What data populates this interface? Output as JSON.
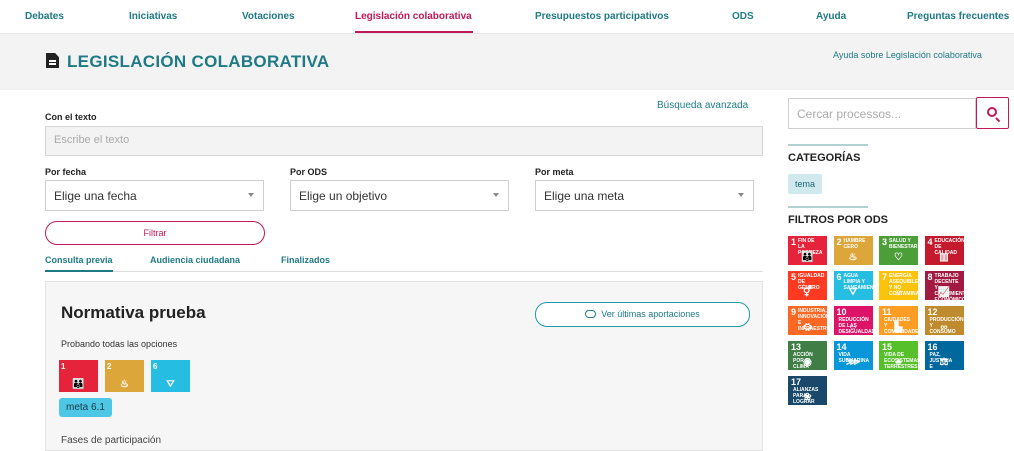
{
  "nav": {
    "items": [
      {
        "label": "Debates",
        "active": false
      },
      {
        "label": "Iniciativas",
        "active": false
      },
      {
        "label": "Votaciones",
        "active": false
      },
      {
        "label": "Legislación colaborativa",
        "active": true
      },
      {
        "label": "Presupuestos participativos",
        "active": false
      },
      {
        "label": "ODS",
        "active": false
      },
      {
        "label": "Ayuda",
        "active": false
      },
      {
        "label": "Preguntas frecuentes",
        "active": false
      }
    ]
  },
  "header": {
    "title": "LEGISLACIÓN COLABORATIVA",
    "title_icon": "document-icon",
    "help_link": "Ayuda sobre Legislación colaborativa"
  },
  "search_form": {
    "advanced_link": "Búsqueda avanzada",
    "text_label": "Con el texto",
    "text_placeholder": "Escribe el texto",
    "date_label": "Por fecha",
    "date_value": "Elige una fecha",
    "ods_label": "Por ODS",
    "ods_value": "Elige un objetivo",
    "meta_label": "Por meta",
    "meta_value": "Elige una meta",
    "filter_button": "Filtrar"
  },
  "tabs": [
    {
      "label": "Consulta previa",
      "active": true
    },
    {
      "label": "Audiencia ciudadana",
      "active": false
    },
    {
      "label": "Finalizados",
      "active": false
    }
  ],
  "card": {
    "title": "Normativa prueba",
    "view_button": "Ver últimas aportaciones",
    "description": "Probando todas las opciones",
    "ods": [
      {
        "number": "1",
        "text": "FIN DE LA POBREZA",
        "color": "#e5243b",
        "glyph": "👪"
      },
      {
        "number": "2",
        "text": "HAMBRE CERO",
        "color": "#dda63a",
        "glyph": "♨"
      },
      {
        "number": "6",
        "text": "AGUA LIMPIA Y SANEAMIENTO",
        "color": "#26bde2",
        "glyph": "⛛"
      }
    ],
    "meta_badge": "meta 6.1",
    "phases_label": "Fases de participación"
  },
  "sidebar": {
    "search_placeholder": "Cercar processos...",
    "categories_title": "CATEGORÍAS",
    "categories": [
      "tema"
    ],
    "ods_title": "FILTROS POR ODS",
    "ods": [
      {
        "number": "1",
        "text": "FIN DE LA POBREZA",
        "color": "#e5243b",
        "glyph": "👪"
      },
      {
        "number": "2",
        "text": "HAMBRE CERO",
        "color": "#dda63a",
        "glyph": "♨"
      },
      {
        "number": "3",
        "text": "SALUD Y BIENESTAR",
        "color": "#4c9f38",
        "glyph": "♡"
      },
      {
        "number": "4",
        "text": "EDUCACIÓN DE CALIDAD",
        "color": "#c5192d",
        "glyph": "▥"
      },
      {
        "number": "5",
        "text": "IGUALDAD DE GÉNERO",
        "color": "#ff3a21",
        "glyph": "⚥"
      },
      {
        "number": "6",
        "text": "AGUA LIMPIA Y SANEAMIENTO",
        "color": "#26bde2",
        "glyph": "⛛"
      },
      {
        "number": "7",
        "text": "ENERGÍA ASEQUIBLE Y NO CONTAMINANTE",
        "color": "#fcc30b",
        "glyph": "☼"
      },
      {
        "number": "8",
        "text": "TRABAJO DECENTE Y CRECIMIENTO ECONÓMICO",
        "color": "#a21942",
        "glyph": "📈"
      },
      {
        "number": "9",
        "text": "INDUSTRIA, INNOVACIÓN E INFRAESTRUCTURA",
        "color": "#fd6925",
        "glyph": "⛭"
      },
      {
        "number": "10",
        "text": "REDUCCIÓN DE LAS DESIGUALDADES",
        "color": "#dd1367",
        "glyph": "⇔"
      },
      {
        "number": "11",
        "text": "CIUDADES Y COMUNIDADES SOSTENIBLES",
        "color": "#fd9d24",
        "glyph": "▙"
      },
      {
        "number": "12",
        "text": "PRODUCCIÓN Y CONSUMO RESPONSABLES",
        "color": "#bf8b2e",
        "glyph": "∞"
      },
      {
        "number": "13",
        "text": "ACCIÓN POR EL CLIMA",
        "color": "#3f7e44",
        "glyph": "◉"
      },
      {
        "number": "14",
        "text": "VIDA SUBMARINA",
        "color": "#0a97d9",
        "glyph": "⋙"
      },
      {
        "number": "15",
        "text": "VIDA DE ECOSISTEMAS TERRESTRES",
        "color": "#56c02b",
        "glyph": "♣"
      },
      {
        "number": "16",
        "text": "PAZ, JUSTICIA E INSTITUCIONES SÓLIDAS",
        "color": "#00689d",
        "glyph": "⚖"
      },
      {
        "number": "17",
        "text": "ALIANZAS PARA LOGRAR LOS OBJETIVOS",
        "color": "#19486a",
        "glyph": "❀"
      }
    ]
  }
}
